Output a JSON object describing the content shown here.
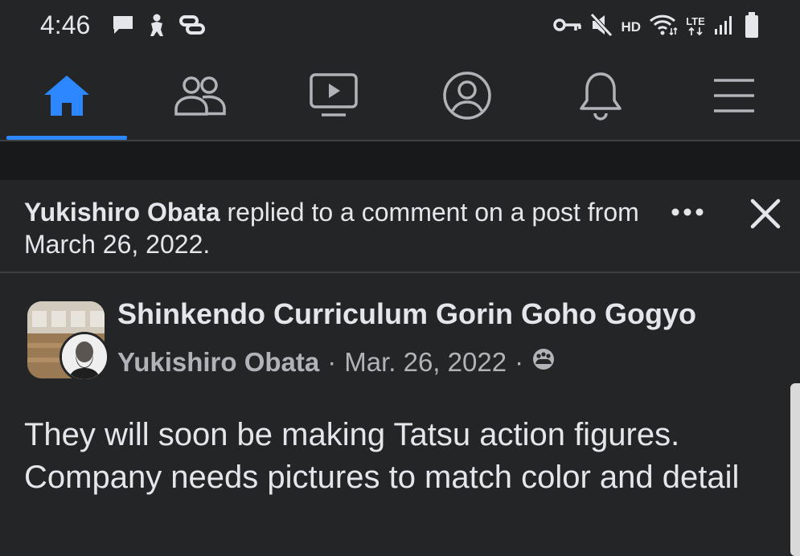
{
  "status_bar": {
    "time": "4:46",
    "left_icons": [
      "message-icon",
      "figure-icon",
      "link-icon"
    ],
    "right_icons": [
      "key-icon",
      "mute-icon",
      "wifi-icon",
      "signal-icon",
      "battery-icon"
    ],
    "hd_label": "HD",
    "lte_label": "LTE"
  },
  "nav": {
    "tabs": [
      {
        "name": "home",
        "icon": "home-icon",
        "active": true
      },
      {
        "name": "friends",
        "icon": "friends-icon",
        "active": false
      },
      {
        "name": "watch",
        "icon": "video-icon",
        "active": false
      },
      {
        "name": "profile",
        "icon": "profile-icon",
        "active": false
      },
      {
        "name": "notifications",
        "icon": "bell-icon",
        "active": false
      },
      {
        "name": "menu",
        "icon": "menu-icon",
        "active": false
      }
    ],
    "accent_color": "#2d88ff"
  },
  "notice": {
    "actor": "Yukishiro Obata",
    "text": " replied to a comment on a post from March 26, 2022."
  },
  "post": {
    "group_name": "Shinkendo Curriculum Gorin Goho Gogyo",
    "author": "Yukishiro Obata",
    "date": "Mar. 26, 2022",
    "separator": "·",
    "privacy_icon": "group-privacy-icon",
    "body": "They will soon be making Tatsu action figures. Company needs pictures to match color and detail"
  },
  "colors": {
    "background": "#242526",
    "band": "#18191a",
    "text": "#e4e6eb",
    "secondary_text": "#b0b3b8"
  }
}
